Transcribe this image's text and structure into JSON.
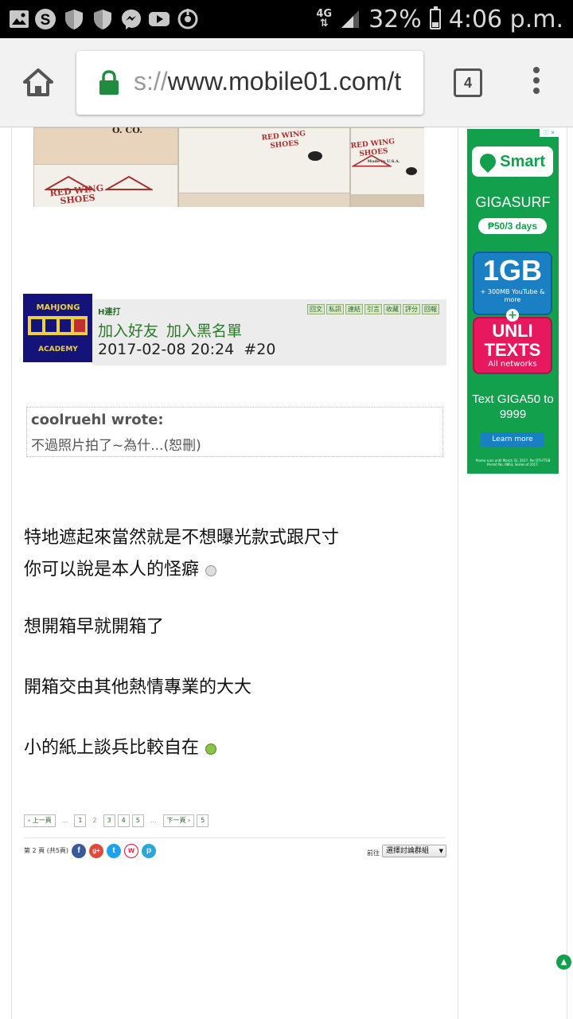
{
  "status_bar": {
    "network": "4G",
    "battery": "32%",
    "time": "4:06 p.m.",
    "icons": [
      "gallery-icon",
      "skype-icon",
      "shield-icon",
      "shield-icon",
      "messenger-icon",
      "youtube-icon",
      "sync-icon"
    ]
  },
  "browser": {
    "url_prefix": "s://",
    "url_main": "www.mobile01.com/t",
    "tab_count": "4",
    "secure_color": "#1e8e3e"
  },
  "post": {
    "username": "H連打",
    "actions": [
      "回文",
      "私訊",
      "連結",
      "引言",
      "收藏",
      "評分",
      "回報"
    ],
    "add_friend": "加入好友",
    "add_blacklist": "加入黑名單",
    "date": "2017-02-08 20:24",
    "floor": "#20",
    "quote": {
      "author": "coolruehl wrote:",
      "text": "不過照片拍了~為什...(恕刪)"
    },
    "lines": [
      "特地遮起來當然就是不想曝光款式跟尺寸",
      "你可以說是本人的怪癖",
      "想開箱早就開箱了",
      "開箱交由其他熱情專業的大大",
      "小的紙上談兵比較自在"
    ]
  },
  "photo": {
    "box_labels": [
      "RED WING SHOES",
      "RED WING SHOES",
      "RED WING SHOES",
      "O. CO."
    ],
    "made_in": "Made in U.S.A."
  },
  "avatar": {
    "line1": "MAHJONG",
    "line2": "ACADEMY"
  },
  "pagination": {
    "prev": "‹ 上一頁",
    "ellipsis": "...",
    "pages": [
      "1",
      "2",
      "3",
      "4",
      "5"
    ],
    "current": "2",
    "next": "下一頁 ›",
    "last": "5",
    "page_info": "第 2 頁 (共5頁)",
    "goto_label": "前往",
    "goto_select": "選擇討論群組"
  },
  "ad": {
    "brand": "Smart",
    "gigasurf": "GIGASURF",
    "price": "₱50/3 days",
    "data_big": "1GB",
    "data_small": "+ 300MB YouTube & more",
    "unli_big": "UNLI TEXTS",
    "unli_small": "All networks",
    "cta": "Text GIGA50 to 9999",
    "learn_more": "Learn more",
    "fine_print": "Promo runs until March 31, 2017. Per DTI-FTEB Permit No. 0863, Series of 2017.",
    "ad_choices": "ⓘ ✕",
    "color": "#12a04d"
  }
}
